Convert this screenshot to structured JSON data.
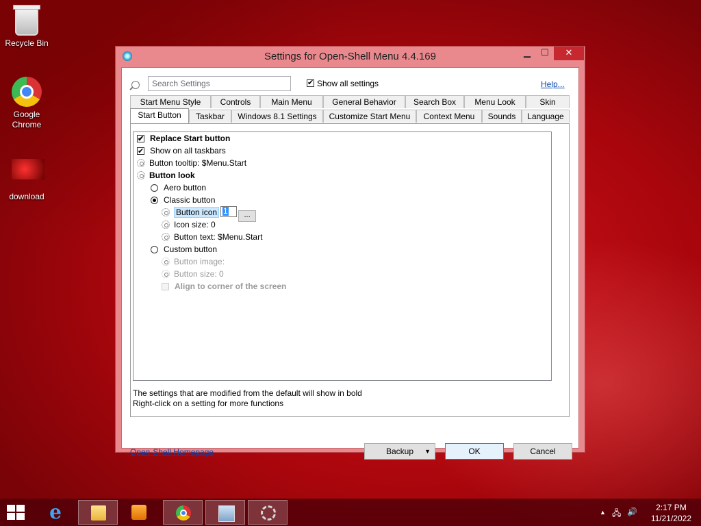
{
  "desktop": {
    "icons": [
      {
        "label": "Recycle Bin"
      },
      {
        "label": "Google Chrome"
      },
      {
        "label": "download"
      }
    ]
  },
  "window": {
    "title": "Settings for Open-Shell Menu 4.4.169",
    "controls": {
      "minimize": "▁",
      "maximize": "☐",
      "close": "✕"
    },
    "search": {
      "placeholder": "Search Settings",
      "value": ""
    },
    "show_all": {
      "label": "Show all settings",
      "checked": true
    },
    "help_link": "Help...",
    "tabs_row1": [
      "Start Menu Style",
      "Controls",
      "Main Menu",
      "General Behavior",
      "Search Box",
      "Menu Look",
      "Skin"
    ],
    "tabs_row2": [
      "Start Button",
      "Taskbar",
      "Windows 8.1 Settings",
      "Customize Start Menu",
      "Context Menu",
      "Sounds",
      "Language"
    ],
    "active_tab": "Start Button",
    "settings": {
      "replace_start_button": "Replace Start button",
      "show_on_all_taskbars": "Show on all taskbars",
      "button_tooltip": "Button tooltip: $Menu.Start",
      "button_look": "Button look",
      "aero_button": "Aero button",
      "classic_button": "Classic button",
      "button_icon": "Button icon",
      "button_icon_value": "1",
      "browse": "...",
      "icon_size": "Icon size: 0",
      "button_text": "Button text: $Menu.Start",
      "custom_button": "Custom button",
      "button_image": "Button image:",
      "button_size": "Button size: 0",
      "align_corner": "Align to corner of the screen"
    },
    "footer_notes": [
      "The settings that are modified from the default will show in bold",
      "Right-click on a setting for more functions"
    ],
    "homepage_link": "Open-Shell Homepage",
    "buttons": {
      "backup": "Backup",
      "backup_caret": "▼",
      "ok": "OK",
      "cancel": "Cancel"
    }
  },
  "taskbar": {
    "items": [
      "start-button",
      "internet-explorer",
      "file-explorer",
      "media-player",
      "google-chrome",
      "system-monitor",
      "settings"
    ],
    "active_items": [
      "file-explorer",
      "settings"
    ],
    "clock_time": "2:17 PM",
    "clock_date": "11/21/2022",
    "tray": {
      "show_hidden": "▲",
      "network": "🖧",
      "volume": "🔊"
    }
  },
  "colors": {
    "desktop_background": "#c0101a",
    "window_frame": "#e9898e",
    "close_button": "#c7282f",
    "link": "#0645ad",
    "taskbar": "#50000a"
  }
}
